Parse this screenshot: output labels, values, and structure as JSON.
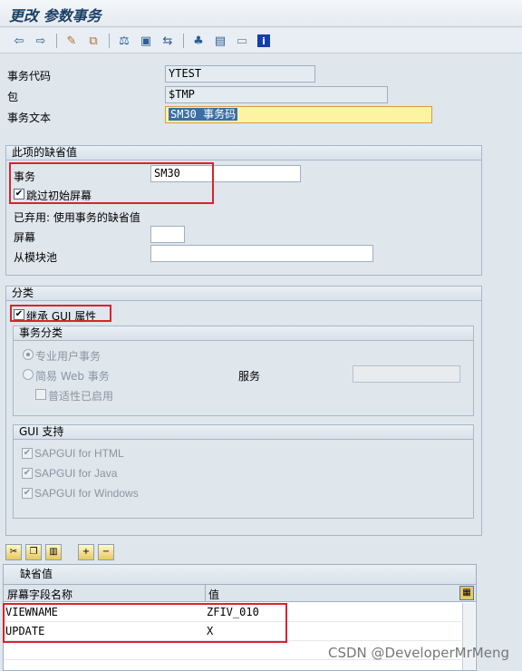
{
  "window": {
    "title": "更改 参数事务"
  },
  "toolbar": {
    "icons": [
      "back-icon",
      "forward-icon",
      "display-change-icon",
      "other-object-icon",
      "check-icon",
      "activate-icon",
      "where-used-icon",
      "hierarchy-icon",
      "object-list-icon",
      "display-object-list-icon",
      "info-icon"
    ]
  },
  "header": {
    "tcode_label": "事务代码",
    "tcode_value": "YTEST",
    "package_label": "包",
    "package_value": "$TMP",
    "text_label": "事务文本",
    "text_value": "SM30 事务码"
  },
  "defaults_group": {
    "title": "此项的缺省值",
    "transaction_label": "事务",
    "transaction_value": "SM30",
    "skip_initial_label": "跳过初始屏幕",
    "skip_initial_checked": true,
    "obsolete_label": "已弃用: 使用事务的缺省值",
    "screen_label": "屏幕",
    "screen_value": "",
    "module_pool_label": "从模块池",
    "module_pool_value": ""
  },
  "classification_group": {
    "title": "分类",
    "inherit_gui_label": "继承 GUI 属性",
    "inherit_gui_checked": true,
    "tx_class": {
      "title": "事务分类",
      "professional_label": "专业用户事务",
      "easy_web_label": "简易 Web 事务",
      "pervasive_label": "普适性已启用",
      "service_label": "服务",
      "service_value": ""
    },
    "gui_support": {
      "title": "GUI 支持",
      "html_label": "SAPGUI for HTML",
      "java_label": "SAPGUI for Java",
      "windows_label": "SAPGUI for Windows"
    }
  },
  "table_toolbar": {
    "icons": [
      "cut-icon",
      "copy-icon",
      "paste-icon",
      "insert-row-icon",
      "delete-row-icon"
    ]
  },
  "defaults_table": {
    "title": "缺省值",
    "columns": [
      "屏幕字段名称",
      "值"
    ],
    "rows": [
      {
        "field": "VIEWNAME",
        "value": "ZFIV_010"
      },
      {
        "field": "UPDATE",
        "value": "X"
      }
    ]
  },
  "watermark": "CSDN @DeveloperMrMeng"
}
